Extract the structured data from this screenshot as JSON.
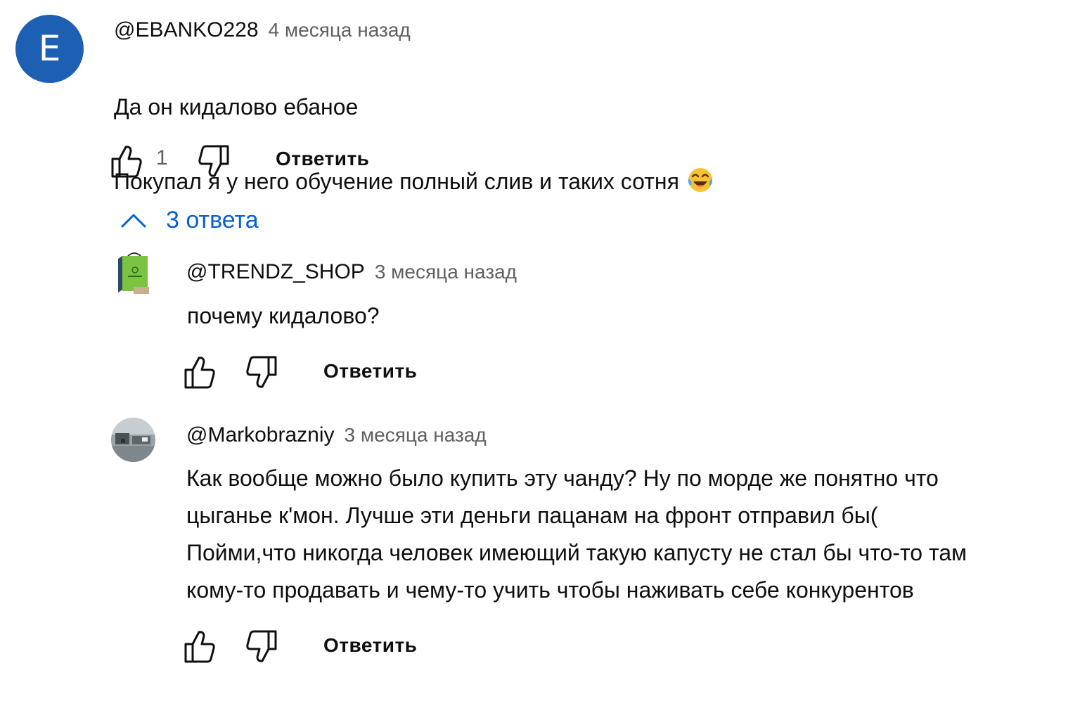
{
  "colors": {
    "link": "#065fd4",
    "muted": "#606060",
    "avatar_bg": "#1d5fb3"
  },
  "comment": {
    "avatar_letter": "E",
    "author": "@EBANKO228",
    "time": "4 месяца назад",
    "text_line1": "Да он кидалово ебаное",
    "text_line2": "Покупал я у него обучение полный слив и таких сотня",
    "emoji": "face-with-tears-of-joy",
    "like_count": "1",
    "reply_label": "Ответить"
  },
  "replies_toggle": {
    "label": "3 ответа",
    "icon": "chevron-up-icon"
  },
  "replies": [
    {
      "author": "@TRENDZ_SHOP",
      "time": "3 месяца назад",
      "text": "почему кидалово?",
      "reply_label": "Ответить"
    },
    {
      "author": "@Markobrazniy",
      "time": "3 месяца назад",
      "text_lines": [
        "Как вообще можно было купить эту чанду? Ну по морде же понятно что",
        "цыганье к'мон. Лучше эти деньги пацанам на фронт отправил бы(",
        "Пойми,что никогда человек имеющий такую капусту не стал бы что-то там",
        "кому-то продавать и чему-то учить чтобы наживать себе конкурентов"
      ],
      "reply_label": "Ответить"
    }
  ]
}
